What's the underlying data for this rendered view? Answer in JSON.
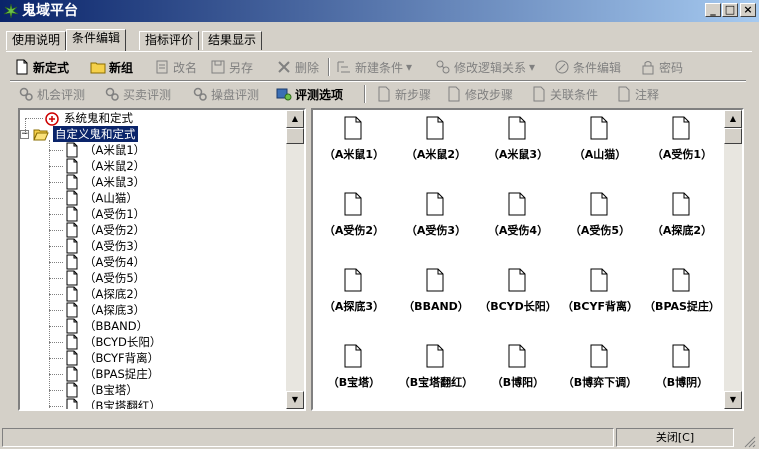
{
  "window": {
    "title": "鬼域平台",
    "min_glyph": "_",
    "max_glyph": "□",
    "close_glyph": "×"
  },
  "tabs": [
    {
      "label": "使用说明",
      "active": false
    },
    {
      "label": "条件编辑",
      "active": true
    },
    {
      "label": "指标评价",
      "active": false
    },
    {
      "label": "结果显示",
      "active": false
    }
  ],
  "toolbar1": [
    {
      "label": "新定式",
      "icon": "new-doc-icon",
      "enabled": true,
      "bold": true
    },
    {
      "label": "新组",
      "icon": "folder-icon",
      "enabled": true,
      "bold": true
    },
    {
      "label": "改名",
      "icon": "rename-icon",
      "enabled": false
    },
    {
      "label": "另存",
      "icon": "save-icon",
      "enabled": false
    },
    {
      "label": "删除",
      "icon": "delete-x-icon",
      "enabled": false
    },
    {
      "label": "新建条件",
      "icon": "new-condition-icon",
      "enabled": false
    },
    {
      "label": "修改逻辑关系",
      "icon": "logic-icon",
      "enabled": false
    },
    {
      "label": "条件编辑",
      "icon": "edit-condition-icon",
      "enabled": false
    },
    {
      "label": "密码",
      "icon": "lock-icon",
      "enabled": false
    }
  ],
  "toolbar2": [
    {
      "label": "机会评测",
      "icon": "gears-icon",
      "enabled": false
    },
    {
      "label": "买卖评测",
      "icon": "gears-icon",
      "enabled": false
    },
    {
      "label": "操盘评测",
      "icon": "gears-icon",
      "enabled": false
    },
    {
      "label": "评测选项",
      "icon": "evaluate-options-icon",
      "enabled": true
    },
    {
      "label": "新步骤",
      "icon": "page-icon",
      "enabled": false
    },
    {
      "label": "修改步骤",
      "icon": "page-icon",
      "enabled": false
    },
    {
      "label": "关联条件",
      "icon": "page-icon",
      "enabled": false
    },
    {
      "label": "注释",
      "icon": "page-icon",
      "enabled": false
    }
  ],
  "tree": {
    "root_system": "系统鬼和定式",
    "root_custom": "自定义鬼和定式",
    "items": [
      "（A米鼠1）",
      "（A米鼠2）",
      "（A米鼠3）",
      "（A山猫）",
      "（A受伤1）",
      "（A受伤2）",
      "（A受伤3）",
      "（A受伤4）",
      "（A受伤5）",
      "（A探底2）",
      "（A探底3）",
      "（BBAND）",
      "（BCYD长阳）",
      "（BCYF背离）",
      "（BPAS捉庄）",
      "（B宝塔）",
      "（B宝塔翻红）"
    ]
  },
  "icons": [
    "（A米鼠1）",
    "（A米鼠2）",
    "（A米鼠3）",
    "（A山猫）",
    "（A受伤1）",
    "（A受伤2）",
    "（A受伤3）",
    "（A受伤4）",
    "（A受伤5）",
    "（A探底2）",
    "（A探底3）",
    "（BBAND）",
    "（BCYD长阳）",
    "（BCYF背离）",
    "（BPAS捉庄）",
    "（B宝塔）",
    "（B宝塔翻红）",
    "（B博阳）",
    "（B博弈下调）",
    "（B博阴）"
  ],
  "status": {
    "close_button": "关闭[C]"
  },
  "colors": {
    "title_start": "#0a246a",
    "title_end": "#a6caf0",
    "selection": "#0a246a",
    "face": "#d4d0c8"
  }
}
